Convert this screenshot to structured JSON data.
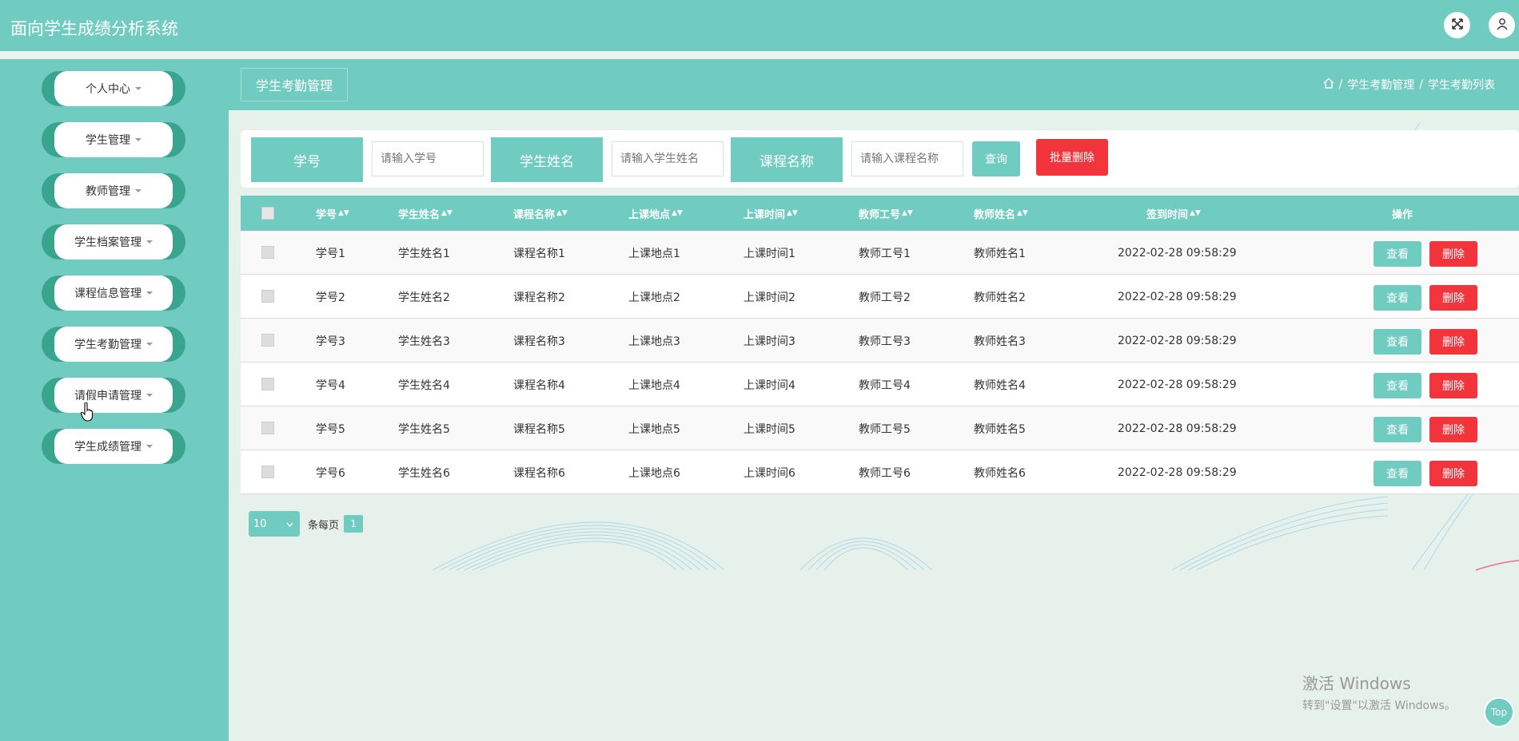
{
  "header": {
    "title": "面向学生成绩分析系统"
  },
  "sidebar": {
    "items": [
      {
        "label": "个人中心"
      },
      {
        "label": "学生管理"
      },
      {
        "label": "教师管理"
      },
      {
        "label": "学生档案管理"
      },
      {
        "label": "课程信息管理"
      },
      {
        "label": "学生考勤管理"
      },
      {
        "label": "请假申请管理"
      },
      {
        "label": "学生成绩管理"
      }
    ]
  },
  "main": {
    "module_title": "学生考勤管理",
    "breadcrumb": [
      "学生考勤管理",
      "学生考勤列表"
    ],
    "breadcrumb_sep": "/"
  },
  "search": {
    "fields": [
      {
        "label": "学号",
        "placeholder": "请输入学号"
      },
      {
        "label": "学生姓名",
        "placeholder": "请输入学生姓名"
      },
      {
        "label": "课程名称",
        "placeholder": "请输入课程名称"
      }
    ],
    "query_label": "查询",
    "batch_delete_label": "批量删除"
  },
  "table": {
    "columns": [
      "学号",
      "学生姓名",
      "课程名称",
      "上课地点",
      "上课时间",
      "教师工号",
      "教师姓名",
      "签到时间",
      "操作"
    ],
    "sort_icon": "▲▼",
    "view_label": "查看",
    "delete_label": "删除",
    "rows": [
      [
        "学号1",
        "学生姓名1",
        "课程名称1",
        "上课地点1",
        "上课时间1",
        "教师工号1",
        "教师姓名1",
        "2022-02-28 09:58:29"
      ],
      [
        "学号2",
        "学生姓名2",
        "课程名称2",
        "上课地点2",
        "上课时间2",
        "教师工号2",
        "教师姓名2",
        "2022-02-28 09:58:29"
      ],
      [
        "学号3",
        "学生姓名3",
        "课程名称3",
        "上课地点3",
        "上课时间3",
        "教师工号3",
        "教师姓名3",
        "2022-02-28 09:58:29"
      ],
      [
        "学号4",
        "学生姓名4",
        "课程名称4",
        "上课地点4",
        "上课时间4",
        "教师工号4",
        "教师姓名4",
        "2022-02-28 09:58:29"
      ],
      [
        "学号5",
        "学生姓名5",
        "课程名称5",
        "上课地点5",
        "上课时间5",
        "教师工号5",
        "教师姓名5",
        "2022-02-28 09:58:29"
      ],
      [
        "学号6",
        "学生姓名6",
        "课程名称6",
        "上课地点6",
        "上课时间6",
        "教师工号6",
        "教师姓名6",
        "2022-02-28 09:58:29"
      ]
    ]
  },
  "pager": {
    "page_size": "10",
    "page_size_suffix": "条每页",
    "current_page": "1"
  },
  "watermark": {
    "line1": "激活 Windows",
    "line2": "转到\"设置\"以激活 Windows。"
  },
  "top_button": "Top",
  "colors": {
    "primary": "#70cbc0",
    "danger": "#f2353c",
    "sidebar_pill_edge": "#3aa58f"
  },
  "icons": {
    "fullscreen": "fullscreen-icon",
    "user": "user-icon",
    "home": "home-icon"
  }
}
